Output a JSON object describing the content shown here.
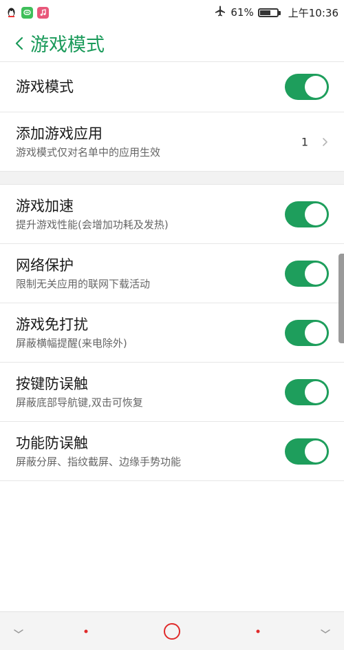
{
  "status_bar": {
    "battery_percent_label": "61%",
    "battery_level": 0.61,
    "time": "上午10:36",
    "notification_icons": [
      "qq-icon",
      "message-icon",
      "music-icon"
    ]
  },
  "header": {
    "title": "游戏模式"
  },
  "settings": [
    {
      "title": "游戏模式",
      "subtitle": "",
      "control": "toggle",
      "on": true
    },
    {
      "title": "添加游戏应用",
      "subtitle": "游戏模式仅对名单中的应用生效",
      "control": "count",
      "count": "1"
    },
    {
      "title": "游戏加速",
      "subtitle": "提升游戏性能(会增加功耗及发热)",
      "control": "toggle",
      "on": true
    },
    {
      "title": "网络保护",
      "subtitle": "限制无关应用的联网下载活动",
      "control": "toggle",
      "on": true
    },
    {
      "title": "游戏免打扰",
      "subtitle": "屏蔽横幅提醒(来电除外)",
      "control": "toggle",
      "on": true
    },
    {
      "title": "按键防误触",
      "subtitle": "屏蔽底部导航键,双击可恢复",
      "control": "toggle",
      "on": true
    },
    {
      "title": "功能防误触",
      "subtitle": "屏蔽分屏、指纹截屏、边缘手势功能",
      "control": "toggle",
      "on": true
    }
  ],
  "colors": {
    "accent": "#1a9a5a",
    "toggle_on": "#1e9e5c",
    "nav_accent": "#e02a2a"
  }
}
